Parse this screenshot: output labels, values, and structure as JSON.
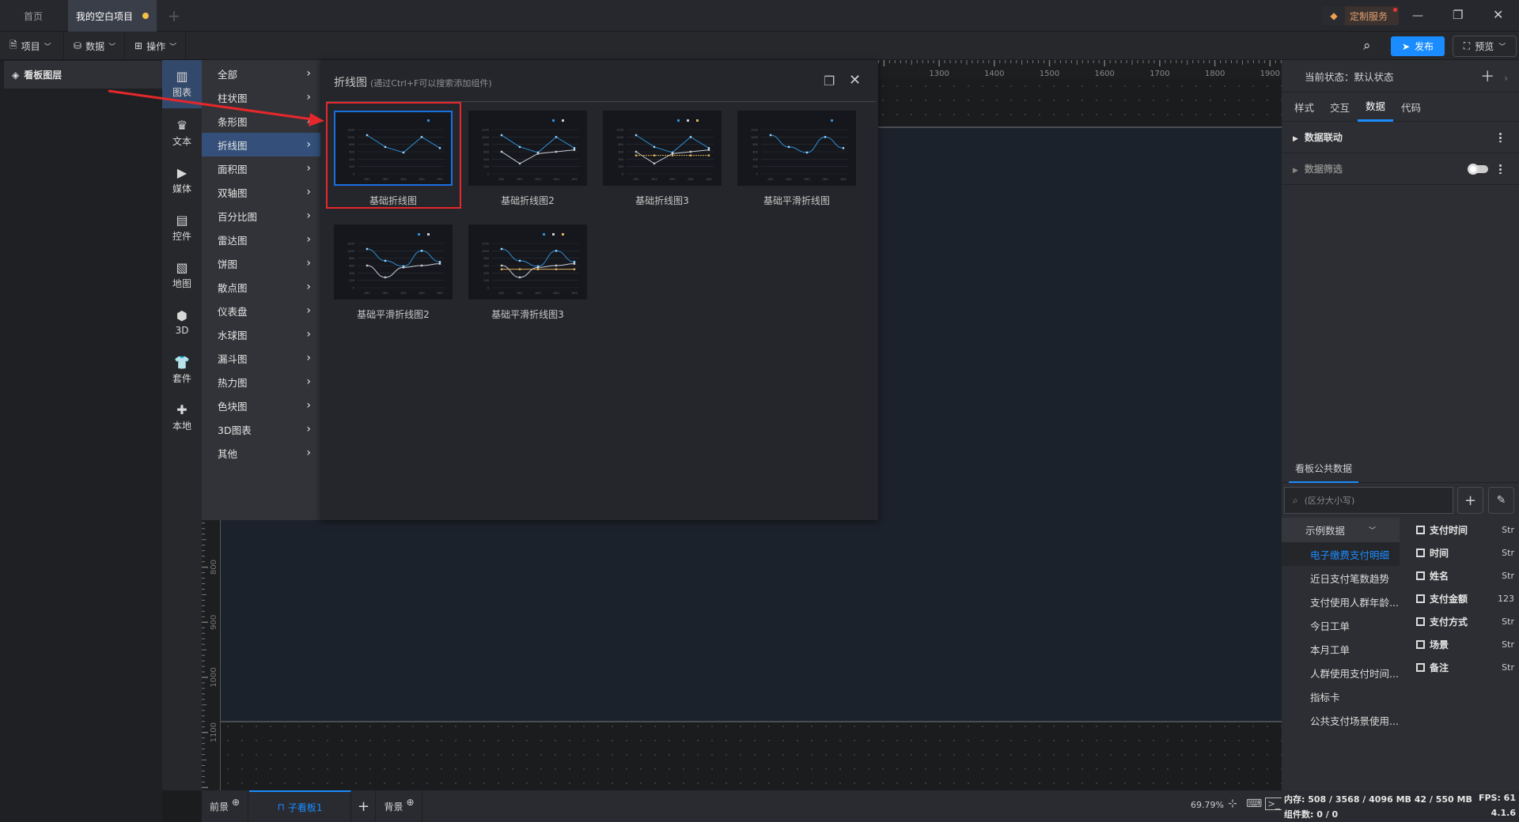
{
  "tabs": [
    {
      "label": "首页",
      "active": false
    },
    {
      "label": "我的空白项目",
      "active": true,
      "unsaved": true
    }
  ],
  "window": {
    "custom_service": "定制服务"
  },
  "toolbar": {
    "items": [
      "项目",
      "数据",
      "操作"
    ],
    "publish": "发布",
    "preview": "预览"
  },
  "left_panel": {
    "title": "看板图层"
  },
  "icon_sidebar": [
    {
      "label": "图表",
      "icon": "bar-chart-icon",
      "active": true
    },
    {
      "label": "文本",
      "icon": "text-icon"
    },
    {
      "label": "媒体",
      "icon": "media-icon"
    },
    {
      "label": "控件",
      "icon": "widget-icon"
    },
    {
      "label": "地图",
      "icon": "map-icon"
    },
    {
      "label": "3D",
      "icon": "cube-icon"
    },
    {
      "label": "套件",
      "icon": "kit-icon"
    },
    {
      "label": "本地",
      "icon": "puzzle-icon"
    }
  ],
  "category_menu": [
    "全部",
    "柱状图",
    "条形图",
    "折线图",
    "面积图",
    "双轴图",
    "百分比图",
    "雷达图",
    "饼图",
    "散点图",
    "仪表盘",
    "水球图",
    "漏斗图",
    "热力图",
    "色块图",
    "3D图表",
    "其他"
  ],
  "category_active": 3,
  "popup": {
    "title": "折线图",
    "hint": "(通过Ctrl+F可以搜索添加组件)"
  },
  "gallery": [
    {
      "label": "基础折线图",
      "smooth": false,
      "series": [
        [
          1050,
          730,
          580,
          1000,
          700
        ]
      ],
      "selected": true
    },
    {
      "label": "基础折线图2",
      "smooth": false,
      "series": [
        [
          1050,
          730,
          580,
          1000,
          700
        ],
        [
          600,
          280,
          550,
          600,
          650
        ]
      ]
    },
    {
      "label": "基础折线图3",
      "smooth": false,
      "series": [
        [
          1050,
          730,
          580,
          1000,
          700
        ],
        [
          600,
          280,
          550,
          600,
          650
        ],
        [
          500,
          500,
          500,
          500,
          500
        ]
      ]
    },
    {
      "label": "基础平滑折线图",
      "smooth": true,
      "series": [
        [
          1050,
          730,
          580,
          1000,
          700
        ]
      ]
    },
    {
      "label": "基础平滑折线图2",
      "smooth": true,
      "series": [
        [
          1050,
          730,
          580,
          1000,
          700
        ],
        [
          600,
          280,
          550,
          600,
          650
        ]
      ]
    },
    {
      "label": "基础平滑折线图3",
      "smooth": true,
      "series": [
        [
          1050,
          730,
          580,
          1000,
          700
        ],
        [
          600,
          280,
          550,
          600,
          650
        ],
        [
          500,
          500,
          500,
          500,
          500
        ]
      ]
    }
  ],
  "series_colors": [
    "#2e8fd6",
    "#c8ccd4",
    "#e0b060"
  ],
  "ruler": {
    "top": [
      1300,
      1400,
      1500,
      1600,
      1700,
      1800,
      1900
    ],
    "left": [
      800,
      900,
      1000,
      1100
    ]
  },
  "bottom_tabs": {
    "foreground": "前景",
    "board": "子看板1",
    "background": "背景"
  },
  "right_panel": {
    "state_label": "当前状态：默认状态",
    "tabs": [
      "样式",
      "交互",
      "数据",
      "代码"
    ],
    "active_tab": 2,
    "sections": [
      "数据联动",
      "数据筛选"
    ],
    "public_data_title": "看板公共数据",
    "search_placeholder": "(区分大小写)",
    "group": "示例数据",
    "datasets": [
      "电子缴费支付明细",
      "近日支付笔数趋势",
      "支付使用人群年龄...",
      "今日工单",
      "本月工单",
      "人群使用支付时间...",
      "指标卡",
      "公共支付场景使用..."
    ],
    "active_dataset": 0,
    "fields": [
      {
        "name": "支付时间",
        "type": "Str"
      },
      {
        "name": "时间",
        "type": "Str"
      },
      {
        "name": "姓名",
        "type": "Str"
      },
      {
        "name": "支付金额",
        "type": "123"
      },
      {
        "name": "支付方式",
        "type": "Str"
      },
      {
        "name": "场景",
        "type": "Str"
      },
      {
        "name": "备注",
        "type": "Str"
      }
    ]
  },
  "status": {
    "zoom": "69.79%",
    "memory": "内存: 508 / 3568 / 4096 MB  42 / 550 MB",
    "fps": "FPS:  61",
    "components": "组件数: 0 / 0",
    "version": "4.1.6"
  }
}
